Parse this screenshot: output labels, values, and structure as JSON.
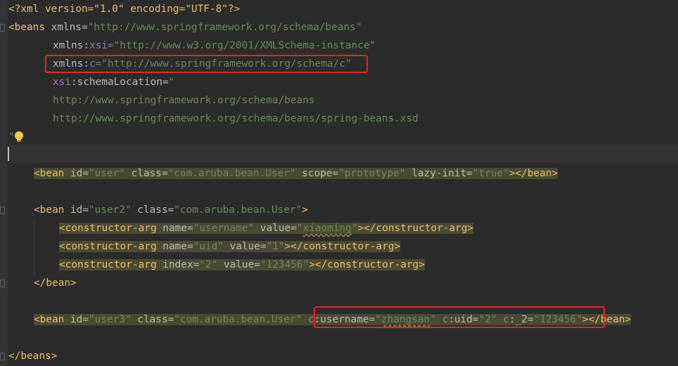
{
  "editor": {
    "lines": {
      "l1": "<?xml version=\"1.0\" encoding=\"UTF-8\"?>",
      "l2_tag": "<beans",
      "l2_attr": " xmlns=",
      "l2_val": "\"http://www.springframework.org/schema/beans\"",
      "l3_attr": "xmlns:",
      "l3_ns": "xsi",
      "l3_val": "=\"http://www.w3.org/2001/XMLSchema-instance\"",
      "l4_attr": "xmlns:",
      "l4_ns": "c",
      "l4_val": "=\"http://www.springframework.org/schema/c\"",
      "l5_ns": "xsi",
      "l5_attr": ":schemaLocation=",
      "l5_val": "\"",
      "l6_val": "http://www.springframework.org/schema/beans",
      "l7_val": "http://www.springframework.org/schema/beans/spring-beans.xsd",
      "l8_val": "\"",
      "l10": {
        "t1": "<bean",
        "a1": " id=",
        "v1": "\"user\"",
        "a2": " class=",
        "v2": "\"com.aruba.bean.User\"",
        "a3": " scope=",
        "v3": "\"prototype\"",
        "a4": " lazy-init=",
        "v4": "\"true\"",
        "t2": "></bean>"
      },
      "l12": {
        "t1": "<bean",
        "a1": " id=",
        "v1": "\"user2\"",
        "a2": " class=",
        "v2": "\"com.aruba.bean.User\"",
        "t2": ">"
      },
      "l13": {
        "t1": "<constructor-arg",
        "a1": " name=",
        "v1": "\"username\"",
        "a2": " value=",
        "v2q1": "\"",
        "v2": "xiaoming",
        "v2q2": "\"",
        "t2": "></constructor-arg>"
      },
      "l14": {
        "t1": "<constructor-arg",
        "a1": " name=",
        "v1": "\"uid\"",
        "a2": " value=",
        "v2": "\"1\"",
        "t2": "></constructor-arg>"
      },
      "l15": {
        "t1": "<constructor-arg",
        "a1": " index=",
        "v1": "\"2\"",
        "a2": " value=",
        "v2": "\"123456\"",
        "t2": "></constructor-arg>"
      },
      "l16": "</bean>",
      "l18": {
        "t1": "<bean",
        "a1": " id=",
        "v1": "\"user3\"",
        "a2": " class=",
        "v2": "\"com.aruba.bean.User\"",
        "sp": " ",
        "n1": "c",
        "a3": ":username=",
        "v3q1": "\"",
        "v3": "zhangsan",
        "v3q2": "\"",
        "sp2": " ",
        "n2": "c",
        "a4": ":uid=",
        "v4": "\"2\"",
        "sp3": " ",
        "n3": "c",
        "a5": ":_2=",
        "v5": "\"123456\"",
        "t2": "></bean>"
      },
      "l20": "</beans>"
    }
  }
}
